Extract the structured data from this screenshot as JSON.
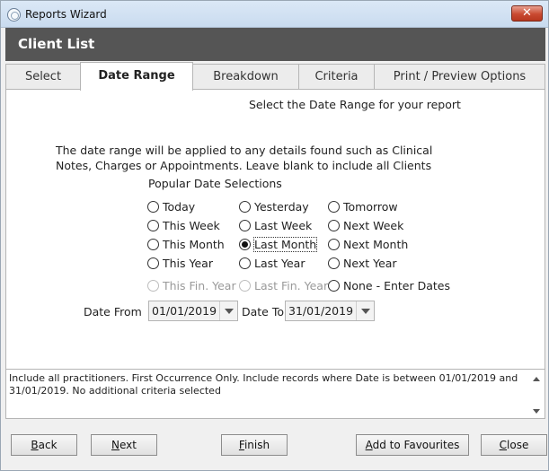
{
  "window": {
    "title": "Reports Wizard"
  },
  "header": {
    "title": "Client List"
  },
  "tabs": [
    {
      "label": "Select"
    },
    {
      "label": "Date Range"
    },
    {
      "label": "Breakdown"
    },
    {
      "label": "Criteria"
    },
    {
      "label": "Print / Preview Options"
    }
  ],
  "content": {
    "heading": "Select the Date Range for your report",
    "info_line1": "The date range will be applied to any details found such as Clinical",
    "info_line2": "Notes, Charges or Appointments.  Leave blank to include all Clients",
    "popular_label": "Popular Date Selections",
    "options": {
      "today": "Today",
      "yesterday": "Yesterday",
      "tomorrow": "Tomorrow",
      "this_week": "This Week",
      "last_week": "Last Week",
      "next_week": "Next Week",
      "this_month": "This Month",
      "last_month": "Last Month",
      "next_month": "Next Month",
      "this_year": "This Year",
      "last_year": "Last Year",
      "next_year": "Next Year",
      "this_fin_year": "This Fin. Year",
      "last_fin_year": "Last Fin. Year",
      "none_enter_dates": "None - Enter Dates"
    },
    "selected_option": "last_month",
    "date_from_label": "Date From",
    "date_from_value": "01/01/2019",
    "date_to_label": "Date To",
    "date_to_value": "31/01/2019"
  },
  "summary": {
    "text": "Include all practitioners. First Occurrence Only. Include records where Date is between 01/01/2019 and 31/01/2019. No additional criteria selected"
  },
  "buttons": {
    "back_u": "B",
    "back_rest": "ack",
    "next_u": "N",
    "next_rest": "ext",
    "finish_u": "F",
    "finish_rest": "inish",
    "favourites_u": "A",
    "favourites_rest": "dd to Favourites",
    "close_u": "C",
    "close_rest": "lose"
  },
  "colors": {
    "header_bg": "#555555",
    "close_button": "#c94a31"
  }
}
